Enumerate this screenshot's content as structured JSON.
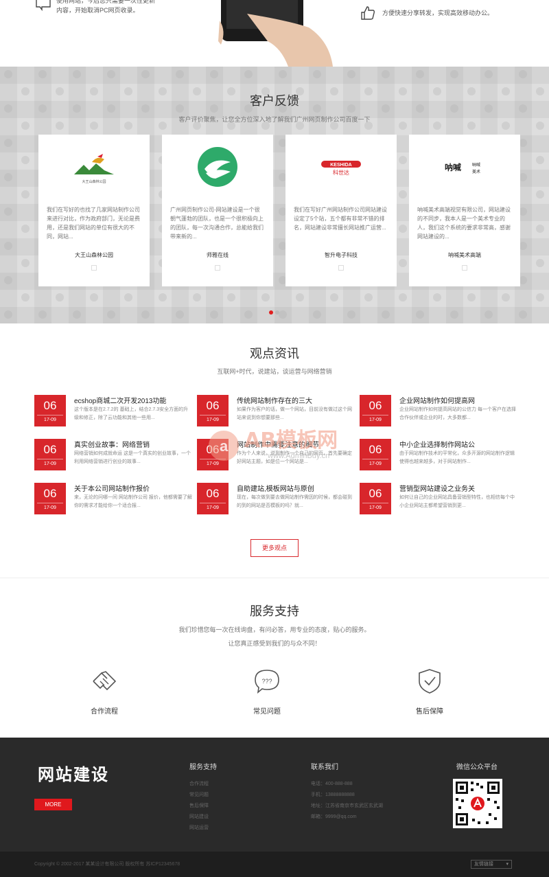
{
  "top": {
    "feature_left": [
      "使用网站，今后您只需要一次性更新",
      "内容，开始取消PC网页收录。"
    ],
    "feature_right": "方便快速分享转发，实现高效移动办公。"
  },
  "feedback": {
    "title": "客户反馈",
    "subtitle": "客户评价聚焦，让您全方位深入地了解我们广州网页制作公司百度一下",
    "cards": [
      {
        "text": "我们在写好的也找了几家网站制作公司来进行对比，作为政府部门，无论是费用，还是我们网站的单位有很大的不同，网站...",
        "name": "大王山森林公园",
        "logo_text": "大王山森林公园"
      },
      {
        "text": "广州网页制作公司-网站建设是一个很朝气蓬勃的团队，也是一个很积极向上的团队，每一次沟通合作，总能给我们带来新的...",
        "name": "师雅在线",
        "logo_text": ""
      },
      {
        "text": "我们在写好广州网站制作公司网站建设设定了5个站，五个都有非常不错的排名，网站建设非常擅长网站推广运营...",
        "name": "智升电子科技",
        "logo_text": "KESHIDA"
      },
      {
        "text": "呐喊美术高端视觉有限公司，网站建设的不同步，我本人是一个美术专业的人，我们这个系统的要求非常高，感谢网站建设的...",
        "name": "呐喊美术高端",
        "logo_text": "呐喊"
      }
    ]
  },
  "news": {
    "title": "观点资讯",
    "subtitle": "互联网+时代，说建站，谈运营与网络营销",
    "items": [
      {
        "day": "06",
        "month": "17-09",
        "title": "ecshop商城二次开发2013功能",
        "desc": "这个版本是在2.7.2的 基础上，结合2.7.3安全方面的升级和修正，除了云功能和其他一些用..."
      },
      {
        "day": "06",
        "month": "17-09",
        "title": "传统网站制作存在的三大",
        "desc": "如果作为客户的话，做一个网站，目前没有做过这个网站来说到你想要那些..."
      },
      {
        "day": "06",
        "month": "17-09",
        "title": "企业网站制作如何提高网",
        "desc": "企业网站制作如何提高网站的公信力 每一个客户在选择合作伙伴或企业的时，大多数都..."
      },
      {
        "day": "06",
        "month": "17-09",
        "title": "真实创业故事：网络营销",
        "desc": "网络营销如何成就命运 这是一个真实的创业故事，一个利用网络营销进行创业的故事..."
      },
      {
        "day": "06",
        "month": "17-09",
        "title": "网站制作中需要注意的细节",
        "desc": "作为个人来说，说到制作一个自己的网页，首先要确定好网站主题，如是位一个网站是..."
      },
      {
        "day": "06",
        "month": "17-09",
        "title": "中小企业选择制作网站公",
        "desc": "由于网站制作技术的平常化，众多开源的网站制作逻辑使得也越来越多，对于网站制作..."
      },
      {
        "day": "06",
        "month": "17-09",
        "title": "关于本公司网站制作报价",
        "desc": "来，无论的问哪一间 网站制作公司 报价，他都需要了解你的需求才能给你一个适合报..."
      },
      {
        "day": "06",
        "month": "17-09",
        "title": "自助建站,模板网站与原创",
        "desc": "现在，每次做到要去做网站制作需因的时候，都会碰到的到的网站是否模板的吗？就..."
      },
      {
        "day": "06",
        "month": "17-09",
        "title": "营销型网站建设之业务关",
        "desc": "如何让自己的企业网站具备营销型特性，也相信每个中小企业网站主都希望营销到更..."
      }
    ],
    "more_label": "更多观点"
  },
  "service": {
    "title": "服务支持",
    "subtitle1": "我们珍惜您每一次在线询盘，有问必答，用专业的态度，贴心的服务。",
    "subtitle2": "让您真正感受到我们的与众不同！",
    "items": [
      {
        "label": "合作流程",
        "icon": "handshake-icon"
      },
      {
        "label": "常见问题",
        "icon": "question-bubble-icon"
      },
      {
        "label": "售后保障",
        "icon": "shield-check-icon"
      }
    ]
  },
  "footer": {
    "brand": "网站建设",
    "more": "MORE",
    "col1_title": "服务支持",
    "col1_links": [
      "合作流程",
      "常见问题",
      "售后保障",
      "网站建设",
      "网站运营"
    ],
    "col2_title": "联系我们",
    "col2_lines": [
      "电话：400-888-888",
      "手机：13888888888",
      "地址：江苏省南京市玄武区玄武湖",
      "邮箱：9999@qq.com"
    ],
    "col3_title": "微信公众平台",
    "copyright": "Copyright © 2002-2017 某某设计有限公司 版权所有 苏ICP12345678",
    "select_label": "友情链接"
  },
  "watermark": {
    "text": "AB模板网",
    "sub": "www.AdminBuy.cn"
  }
}
